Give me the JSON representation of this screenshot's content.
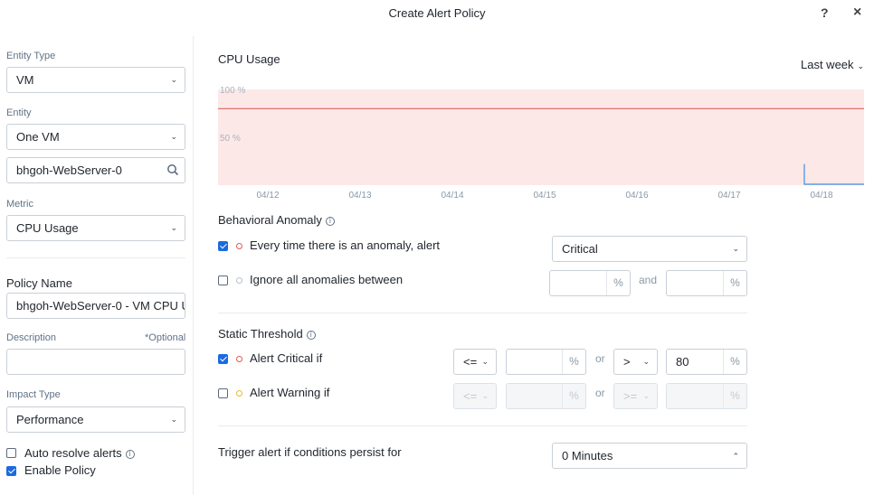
{
  "dialog": {
    "title": "Create Alert Policy",
    "help_label": "?",
    "close_label": "×"
  },
  "left": {
    "entity_type_label": "Entity Type",
    "entity_type_value": "VM",
    "entity_label": "Entity",
    "entity_value": "One VM",
    "entity_search_value": "bhgoh-WebServer-0",
    "metric_label": "Metric",
    "metric_value": "CPU Usage",
    "policy_name_label": "Policy Name",
    "policy_name_value": "bhgoh-WebServer-0 - VM CPU U",
    "description_label": "Description",
    "optional_label": "*Optional",
    "description_value": "",
    "impact_type_label": "Impact Type",
    "impact_type_value": "Performance",
    "auto_resolve_label": "Auto resolve alerts",
    "auto_resolve_checked": false,
    "enable_policy_label": "Enable Policy",
    "enable_policy_checked": true
  },
  "chart": {
    "title": "CPU Usage",
    "range_label": "Last week",
    "accent_fill": "#fde8e8",
    "accent_line": "#d9534f"
  },
  "chart_data": {
    "type": "line",
    "title": "CPU Usage",
    "x": [
      "04/12",
      "04/13",
      "04/14",
      "04/15",
      "04/16",
      "04/17",
      "04/18"
    ],
    "y_ticks": [
      "100 %",
      "50 %"
    ],
    "ylim": [
      0,
      100
    ],
    "threshold_line": 80,
    "series": [
      {
        "values": [
          null,
          null,
          null,
          null,
          null,
          null,
          0.5
        ]
      }
    ]
  },
  "behavioral": {
    "title": "Behavioral Anomaly",
    "row1_label": "Every time there is an anomaly, alert",
    "row1_checked": true,
    "row1_severity": "Critical",
    "row2_label": "Ignore all anomalies between",
    "row2_checked": false,
    "row2_min": "",
    "row2_max": "",
    "and_label": "and",
    "pct": "%"
  },
  "static": {
    "title": "Static Threshold",
    "critical_label": "Alert Critical if",
    "critical_checked": true,
    "critical_op1": "<=",
    "critical_val1": "",
    "or_label": "or",
    "critical_op2": ">",
    "critical_val2": "80",
    "warning_label": "Alert Warning if",
    "warning_checked": false,
    "warning_op1": "<=",
    "warning_val1": "",
    "warning_op2": ">=",
    "warning_val2": "",
    "pct": "%"
  },
  "trigger": {
    "label": "Trigger alert if conditions persist for",
    "value": "0 Minutes"
  },
  "colors": {
    "critical_dot": "#e05a5a",
    "warning_dot": "#e8b931",
    "disabled_dot": "#b8c2cc",
    "checkbox_blue": "#1b6ae0"
  }
}
